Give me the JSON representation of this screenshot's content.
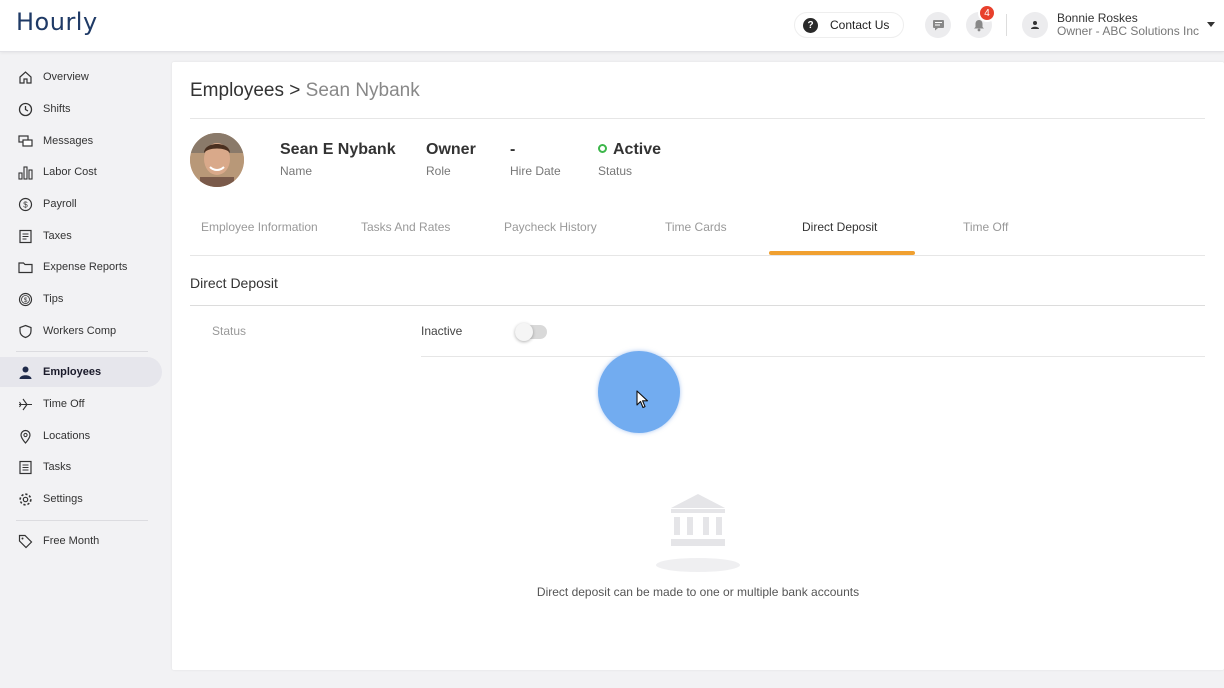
{
  "app": {
    "logo": "Hourly"
  },
  "header": {
    "contact_label": "Contact Us",
    "help_icon": "?",
    "chat_icon": "chat-icon",
    "notifications_count": "4",
    "user_name": "Bonnie Roskes",
    "user_role": "Owner - ABC Solutions Inc"
  },
  "sidebar": {
    "items": [
      {
        "label": "Overview",
        "icon": "home-icon"
      },
      {
        "label": "Shifts",
        "icon": "clock-icon"
      },
      {
        "label": "Messages",
        "icon": "messages-icon"
      },
      {
        "label": "Labor Cost",
        "icon": "bar-chart-icon"
      },
      {
        "label": "Payroll",
        "icon": "dollar-icon"
      },
      {
        "label": "Taxes",
        "icon": "document-icon"
      },
      {
        "label": "Expense Reports",
        "icon": "folder-icon"
      },
      {
        "label": "Tips",
        "icon": "dollar-icon"
      },
      {
        "label": "Workers Comp",
        "icon": "shield-icon"
      },
      {
        "label": "Employees",
        "icon": "person-icon",
        "active": true
      },
      {
        "label": "Time Off",
        "icon": "plane-icon"
      },
      {
        "label": "Locations",
        "icon": "pin-icon"
      },
      {
        "label": "Tasks",
        "icon": "list-icon"
      },
      {
        "label": "Settings",
        "icon": "gear-icon"
      },
      {
        "label": "Free Month",
        "icon": "tag-icon"
      }
    ]
  },
  "breadcrumb": {
    "parent": "Employees",
    "separator": ">",
    "current": "Sean Nybank"
  },
  "employee": {
    "name": "Sean E Nybank",
    "name_label": "Name",
    "role": "Owner",
    "role_label": "Role",
    "hire_date": "-",
    "hire_date_label": "Hire Date",
    "status": "Active",
    "status_label": "Status"
  },
  "tabs": [
    {
      "label": "Employee Information"
    },
    {
      "label": "Tasks And Rates"
    },
    {
      "label": "Paycheck History"
    },
    {
      "label": "Time Cards"
    },
    {
      "label": "Direct Deposit",
      "active": true
    },
    {
      "label": "Time Off"
    }
  ],
  "direct_deposit": {
    "title": "Direct Deposit",
    "status_label": "Status",
    "status_value": "Inactive",
    "toggle_on": false,
    "empty_message": "Direct deposit can be made to one or multiple bank accounts"
  },
  "colors": {
    "accent": "#f0a030",
    "active_status": "#3cb64a",
    "badge": "#e8402c",
    "logo": "#1f3a66"
  }
}
